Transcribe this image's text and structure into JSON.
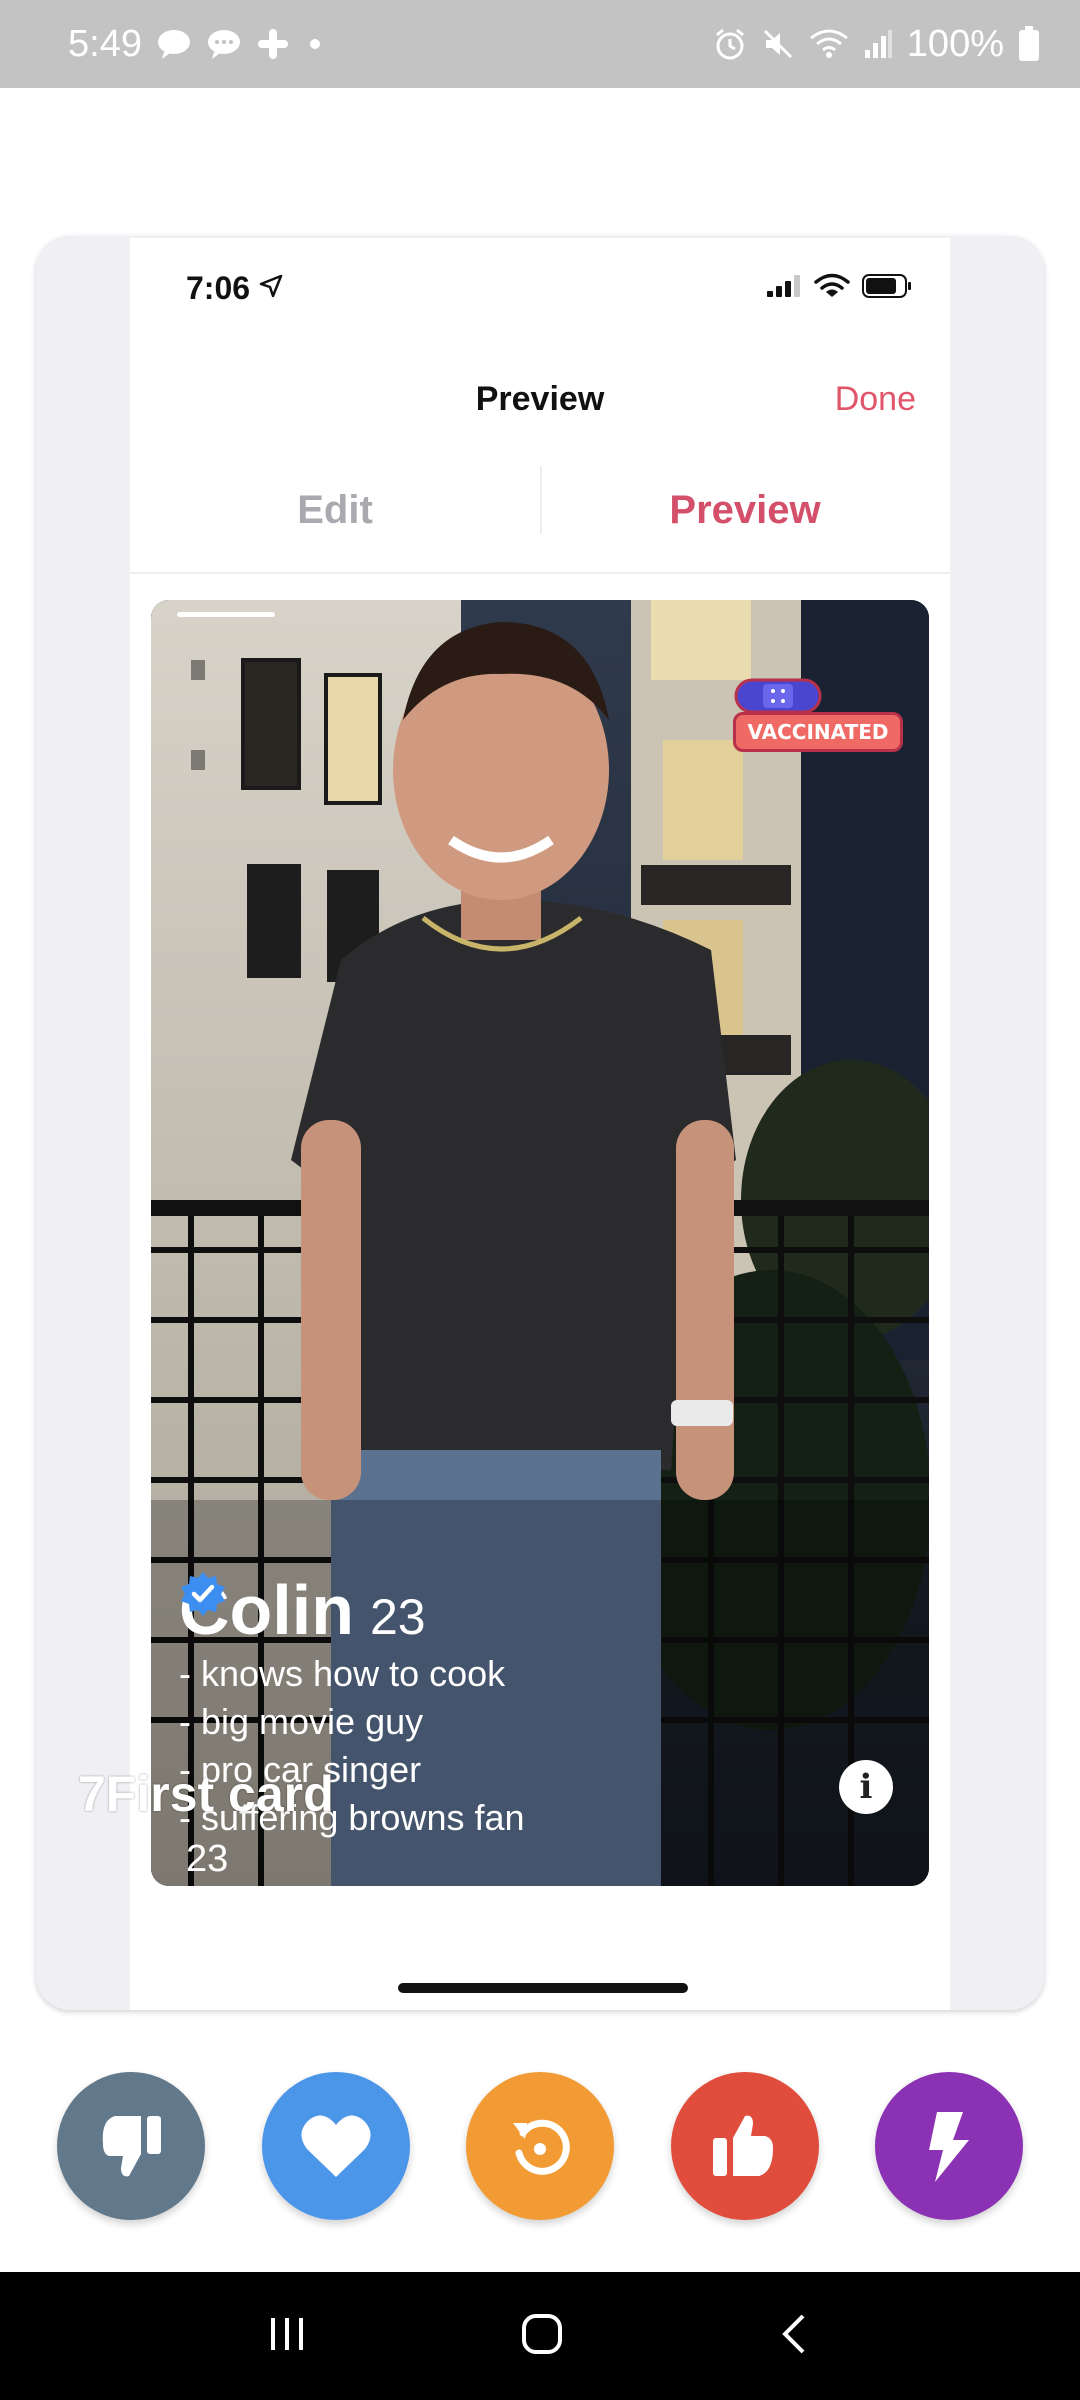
{
  "android_status": {
    "time": "5:49",
    "battery": "100%"
  },
  "ios_status": {
    "time": "7:06"
  },
  "nav": {
    "title": "Preview",
    "done": "Done"
  },
  "tabs": [
    {
      "label": "Edit"
    },
    {
      "label": "Preview"
    }
  ],
  "profile": {
    "name": "Colin",
    "age": "23",
    "badge": "VACCINATED",
    "bio": [
      "- knows how to cook",
      "- big movie guy",
      "- pro car singer",
      "- suffering browns fan"
    ]
  },
  "overlay": {
    "label": "7First card",
    "age": "23"
  },
  "actions": {
    "dislike_icon": "thumbs-down-icon",
    "like_icon": "heart-icon",
    "rewind_icon": "rewind-icon",
    "thumb_icon": "thumbs-up-icon",
    "boost_icon": "lightning-icon"
  },
  "colors": {
    "accent": "#e0556a",
    "dislike": "#62788b",
    "like": "#4c96ea",
    "rewind": "#f29b35",
    "thumbs_up": "#e14d3c",
    "boost": "#8b32b4"
  }
}
